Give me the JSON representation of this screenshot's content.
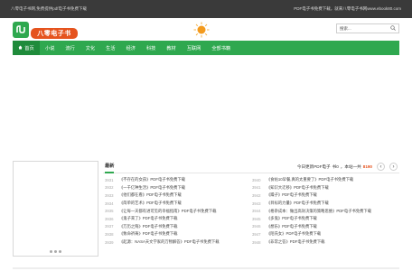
{
  "topbar": {
    "left_text": "八零电子书网,免费提供pdf电子书免费下载",
    "right_text": "PDF电子书免费下载，就来八零电子书网www.ebook80.com"
  },
  "logo": {
    "icon": "logo-book-icon",
    "text": "八零电子书"
  },
  "search": {
    "placeholder": "搜索...",
    "icon": "search-icon"
  },
  "nav": {
    "items": [
      "首页",
      "小说",
      "流行",
      "文化",
      "生活",
      "经济",
      "科技",
      "教材",
      "互联网",
      "全部书籍"
    ],
    "active": 0,
    "color": "#2fa84f",
    "active_color": "#1f8b3b"
  },
  "panel": {
    "title": "最新",
    "stat_prefix": "今日更新PDF电子",
    "stat_today": "书0",
    "stat_mid": "，本站一共",
    "stat_total": "8190",
    "prev_label": "‹",
    "next_label": "›"
  },
  "list_left": [
    {
      "num": "3931",
      "title": "《不存在的女孩》PDF电子书免费下载"
    },
    {
      "num": "3932",
      "title": "《一千亿种生活》PDF电子书免费下载"
    },
    {
      "num": "3933",
      "title": "《他们都在看》PDF电子书免费下载"
    },
    {
      "num": "3934",
      "title": "《简单的艺术》PDF电子书免费下载"
    },
    {
      "num": "3935",
      "title": "《让每一天都有进可见的幸福指南》PDF电子书免费下载"
    },
    {
      "num": "3936",
      "title": "《鬼子来了》PDF电子书免费下载"
    },
    {
      "num": "3937",
      "title": "《万历之殇》PDF电子书免费下载"
    },
    {
      "num": "3938",
      "title": "《致命祈祷》PDF电子书免费下载"
    },
    {
      "num": "3939",
      "title": "《起源：NASA天文学家的万物解答》PDF电子书免费下载"
    }
  ],
  "list_right": [
    {
      "num": "3940",
      "title": "《食帖10早餐,真的太重要了》PDF电子书免费下载"
    },
    {
      "num": "3941",
      "title": "《知识大迁移》PDF电子书免费下载"
    },
    {
      "num": "3942",
      "title": "《躁子》PDF电子书免费下载"
    },
    {
      "num": "3943",
      "title": "《目标的力量》PDF电子书免费下载"
    },
    {
      "num": "3944",
      "title": "《格杂成本：做出高效决策的策略思维》PDF电子书免费下载"
    },
    {
      "num": "3945",
      "title": "《多鬼》PDF电子书免费下载"
    },
    {
      "num": "3946",
      "title": "《想乐》PDF电子书免费下载"
    },
    {
      "num": "3947",
      "title": "《陌氏女》PDF电子书免费下载"
    },
    {
      "num": "3948",
      "title": "《非常之答》PDF电子书免费下载"
    }
  ]
}
